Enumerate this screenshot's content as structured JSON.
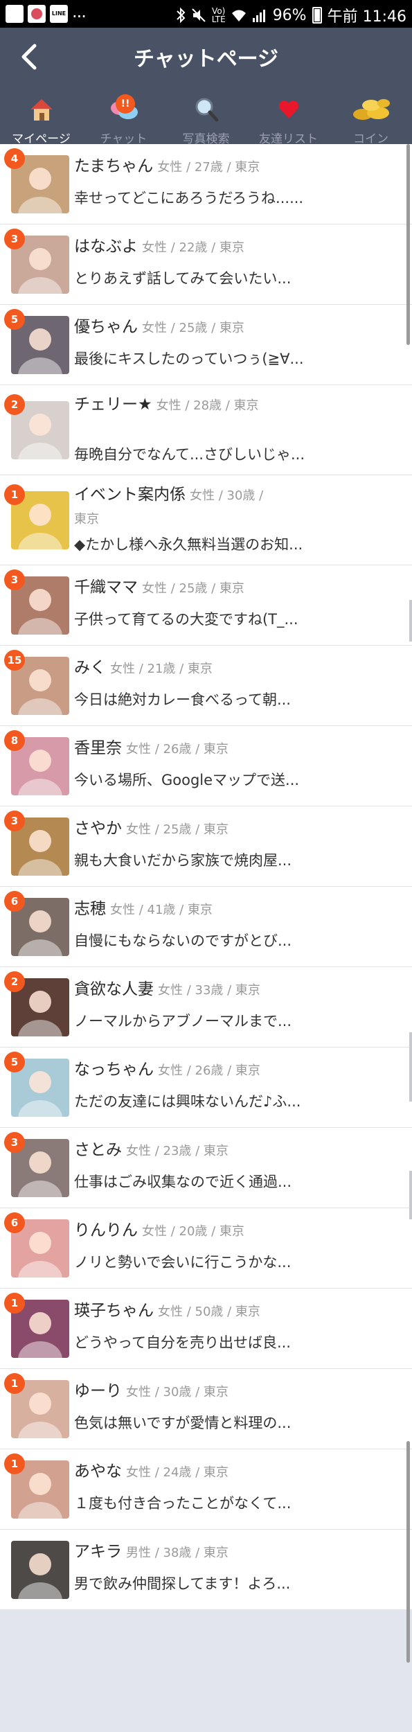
{
  "status_bar": {
    "line_label": "LINE",
    "dots": "...",
    "volte_top": "Vo)",
    "volte_bottom": "LTE",
    "battery": "96%",
    "time": "午前 11:46"
  },
  "header": {
    "title": "チャットページ",
    "tabs": [
      {
        "label": "マイページ",
        "icon": "house-icon",
        "active": true
      },
      {
        "label": "チャット",
        "icon": "chat-bubbles-icon",
        "badge": "!!"
      },
      {
        "label": "写真検索",
        "icon": "magnifier-icon"
      },
      {
        "label": "友達リスト",
        "icon": "heart-icon"
      },
      {
        "label": "コイン",
        "icon": "coins-icon"
      }
    ]
  },
  "chats": [
    {
      "badge": "4",
      "name": "たまちゃん",
      "meta": "女性 / 27歳 / 東京",
      "message": "幸せってどこにあろうだろうね......",
      "avatar_color": "#c8a27a"
    },
    {
      "badge": "3",
      "name": "はなぶよ",
      "meta": "女性 / 22歳 / 東京",
      "message": "とりあえず話してみて会いたい...",
      "avatar_color": "#caa89a"
    },
    {
      "badge": "5",
      "name": "優ちゃん",
      "meta": "女性 / 25歳 / 東京",
      "message": "最後にキスしたのっていつぅ(≧∀...",
      "avatar_color": "#6e6670"
    },
    {
      "badge": "2",
      "name": "チェリー★",
      "meta": "女性 / 28歳 / 東京",
      "message": "毎晩自分でなんて...さびしいじゃ...",
      "avatar_color": "#d7d0cc"
    },
    {
      "badge": "1",
      "name": "イベント案内係",
      "meta": "女性 / 30歳 / 東京",
      "message": "◆たかし様へ永久無料当選のお知...",
      "avatar_color": "#e8c34a"
    },
    {
      "badge": "3",
      "name": "千織ママ",
      "meta": "女性 / 25歳 / 東京",
      "message": "子供って育てるの大変ですね(T_...",
      "avatar_color": "#b07c6a"
    },
    {
      "badge": "15",
      "name": "みく",
      "meta": "女性 / 21歳 / 東京",
      "message": "今日は絶対カレー食べるって朝...",
      "avatar_color": "#c99c86"
    },
    {
      "badge": "8",
      "name": "香里奈",
      "meta": "女性 / 26歳 / 東京",
      "message": "今いる場所、Googleマップで送...",
      "avatar_color": "#d79aa8"
    },
    {
      "badge": "3",
      "name": "さやか",
      "meta": "女性 / 25歳 / 東京",
      "message": "親も大食いだから家族で焼肉屋...",
      "avatar_color": "#b58a52"
    },
    {
      "badge": "6",
      "name": "志穂",
      "meta": "女性 / 41歳 / 東京",
      "message": "自慢にもならないのですがとび...",
      "avatar_color": "#7c6e66"
    },
    {
      "badge": "2",
      "name": "貪欲な人妻",
      "meta": "女性 / 33歳 / 東京",
      "message": "ノーマルからアブノーマルまで...",
      "avatar_color": "#5e4038"
    },
    {
      "badge": "5",
      "name": "なっちゃん",
      "meta": "女性 / 26歳 / 東京",
      "message": "ただの友達には興味ないんだ♪ふ...",
      "avatar_color": "#a9cbd8"
    },
    {
      "badge": "3",
      "name": "さとみ",
      "meta": "女性 / 23歳 / 東京",
      "message": "仕事はごみ収集なので近く通過...",
      "avatar_color": "#8a7a78"
    },
    {
      "badge": "6",
      "name": "りんりん",
      "meta": "女性 / 20歳 / 東京",
      "message": "ノリと勢いで会いに行こうかな...",
      "avatar_color": "#e3a3a0"
    },
    {
      "badge": "1",
      "name": "瑛子ちゃん",
      "meta": "女性 / 50歳 / 東京",
      "message": "どうやって自分を売り出せば良...",
      "avatar_color": "#8a4a6a"
    },
    {
      "badge": "1",
      "name": "ゆーり",
      "meta": "女性 / 30歳 / 東京",
      "message": "色気は無いですが愛情と料理の...",
      "avatar_color": "#d8b0a0"
    },
    {
      "badge": "1",
      "name": "あやな",
      "meta": "女性 / 24歳 / 東京",
      "message": "１度も付き合ったことがなくて...",
      "avatar_color": "#d2a18f"
    },
    {
      "badge": "",
      "name": "アキラ",
      "meta": "男性 / 38歳 / 東京",
      "message": "男で飲み仲間探してます！よろ...",
      "avatar_color": "#4e4a48"
    }
  ]
}
